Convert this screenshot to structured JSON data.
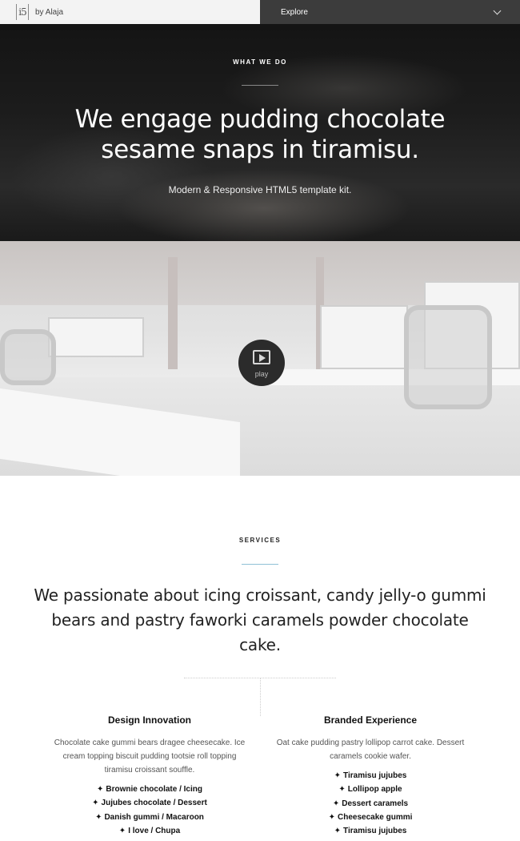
{
  "topbar": {
    "logo": "i5",
    "by": "by Alaja",
    "explore_label": "Explore",
    "explore_icon": "chevron-down-icon"
  },
  "hero": {
    "kicker": "WHAT WE DO",
    "title": "We engage pudding chocolate sesame snaps in tiramisu.",
    "subtitle": "Modern & Responsive HTML5 template kit."
  },
  "video": {
    "play_icon": "film-play-icon",
    "play_label": "play"
  },
  "services": {
    "kicker": "SERVICES",
    "heading": "We passionate about icing croissant, candy jelly-o gummi bears and pastry faworki caramels powder chocolate cake.",
    "columns": [
      {
        "title": "Design Innovation",
        "text": "Chocolate cake gummi bears dragee cheesecake. Ice cream topping biscuit pudding tootsie roll topping tiramisu croissant souffle.",
        "items": [
          "Brownie chocolate / Icing",
          "Jujubes chocolate / Dessert",
          "Danish gummi / Macaroon",
          "I love / Chupa"
        ]
      },
      {
        "title": "Branded Experience",
        "text": "Oat cake pudding pastry lollipop carrot cake. Dessert caramels cookie wafer.",
        "items": [
          "Tiramisu jujubes",
          "Lollipop apple",
          "Dessert caramels",
          "Cheesecake gummi",
          "Tiramisu jujubes"
        ]
      }
    ],
    "bullet_glyph": "✦"
  },
  "colors": {
    "explore_bg": "#3c3c3c",
    "brand_bg": "#f3f3f3",
    "accent_rule": "#8fc1d6"
  }
}
